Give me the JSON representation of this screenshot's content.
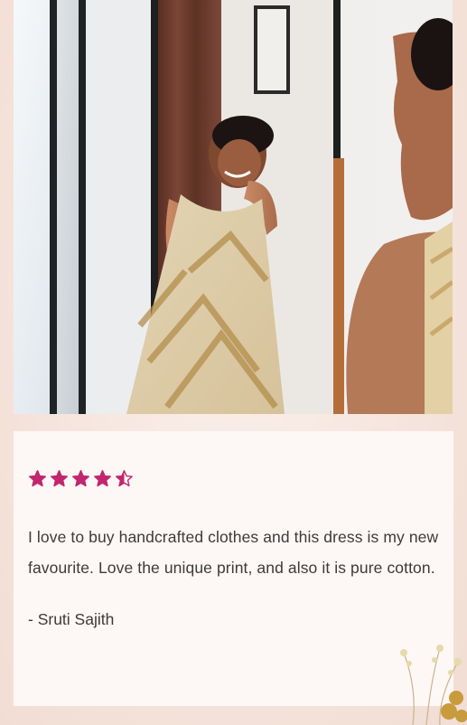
{
  "review": {
    "rating": 4.5,
    "max_rating": 5,
    "text": "I love to buy handcrafted clothes and this dress is my new favourite. Love the unique print, and also it is pure cotton.",
    "author": "- Sruti Sajith"
  },
  "colors": {
    "star": "#c2276d",
    "text": "#3d3a39",
    "card_bg": "#fdf8f6",
    "page_bg": "#f6e8e0"
  },
  "icons": {
    "star": "star-icon",
    "half_star": "half-star-icon"
  }
}
